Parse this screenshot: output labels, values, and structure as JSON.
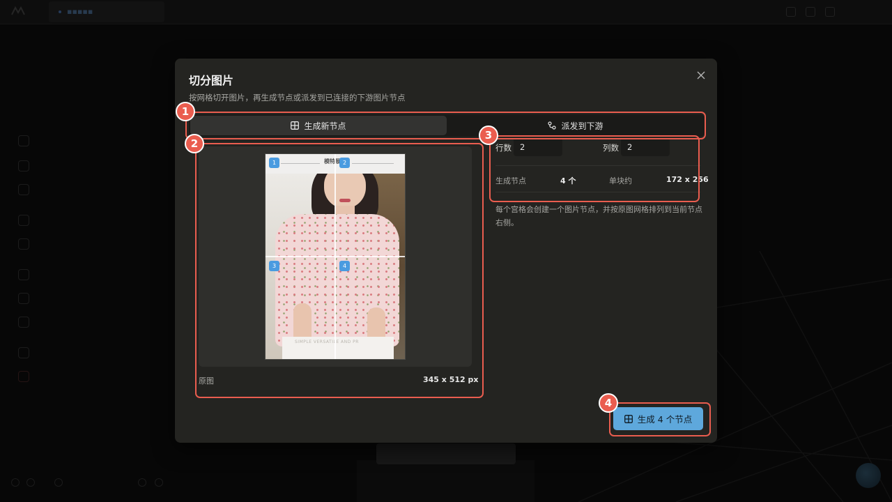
{
  "modal": {
    "title": "切分图片",
    "description": "按网格切开图片，再生成节点或派发到已连接的下游图片节点"
  },
  "mode_tabs": [
    {
      "label": "生成新节点",
      "icon": "grid-icon",
      "active": true
    },
    {
      "label": "派发到下游",
      "icon": "branch-icon",
      "active": false
    }
  ],
  "grid": {
    "rows_label": "行数",
    "rows_value": "2",
    "cols_label": "列数",
    "cols_value": "2"
  },
  "stats": {
    "nodes_label": "生成节点",
    "nodes_value": "4 个",
    "block_label": "单块约",
    "block_value": "172 x 256"
  },
  "note": "每个宫格会创建一个图片节点，并按原图网格排列到当前节点右侧。",
  "preview": {
    "caption": "原图",
    "size": "345 x 512 px",
    "photo_header": "模特展",
    "watermark": "SIMPLE VERSATILE AND PR",
    "cells": [
      "1",
      "2",
      "3",
      "4"
    ]
  },
  "primary_button": {
    "label": "生成 4 个节点",
    "icon": "grid-icon"
  },
  "callouts": [
    "1",
    "2",
    "3",
    "4"
  ],
  "colors": {
    "accent": "#5ea8dc",
    "callout": "#ea5d4f",
    "cell_badge": "#4a9be0",
    "modal_bg": "#242421"
  }
}
